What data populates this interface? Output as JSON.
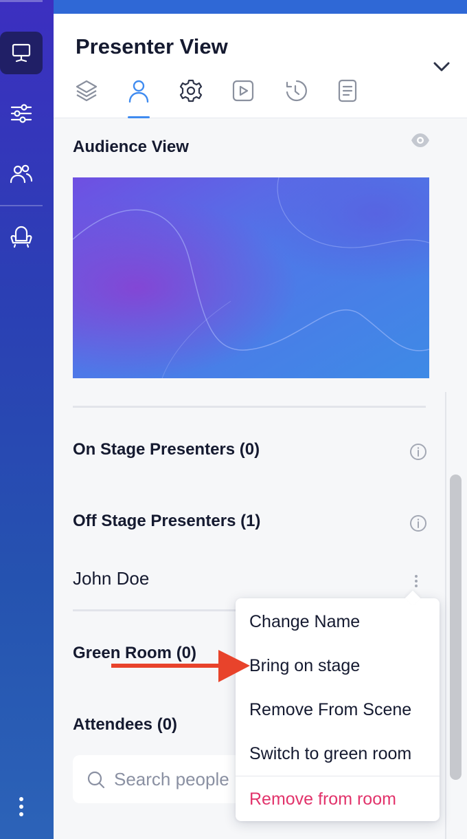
{
  "header": {
    "title": "Presenter View",
    "tabs": [
      {
        "icon": "layers-icon"
      },
      {
        "icon": "person-icon",
        "active": true
      },
      {
        "icon": "gear-icon"
      },
      {
        "icon": "play-icon"
      },
      {
        "icon": "history-icon"
      },
      {
        "icon": "notes-icon"
      }
    ]
  },
  "rail": {
    "items": [
      {
        "icon": "presenter-icon",
        "active": true
      },
      {
        "icon": "sliders-icon"
      },
      {
        "icon": "people-icon"
      },
      {
        "icon": "green-room-icon"
      },
      {
        "icon": "more-icon"
      }
    ]
  },
  "audience": {
    "title": "Audience View"
  },
  "on_stage": {
    "title": "On Stage Presenters (0)"
  },
  "off_stage": {
    "title": "Off Stage Presenters (1)",
    "presenters": [
      "John Doe"
    ]
  },
  "green_room": {
    "title": "Green Room (0)"
  },
  "attendees": {
    "title": "Attendees (0)",
    "search_placeholder": "Search people"
  },
  "menu": {
    "items": [
      "Change Name",
      "Bring on stage",
      "Remove From Scene",
      "Switch to green room"
    ],
    "danger_item": "Remove from room"
  },
  "colors": {
    "accent": "#3f8bf0",
    "danger": "#e2336b",
    "annotation_arrow": "#e8432b"
  }
}
